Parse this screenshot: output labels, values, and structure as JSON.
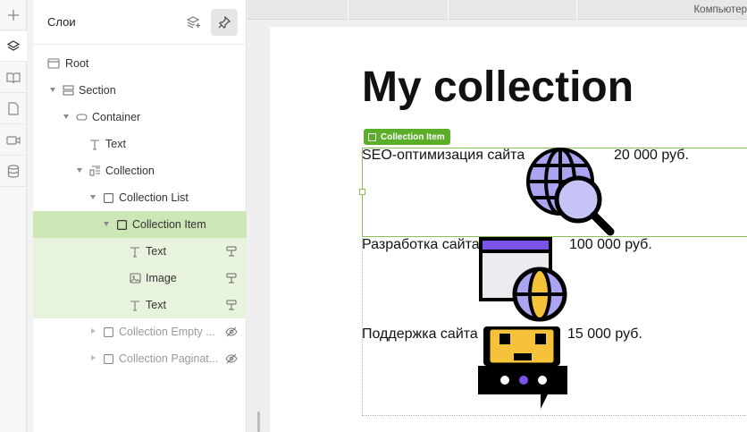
{
  "panel": {
    "title": "Слои"
  },
  "topbar": {
    "device": "Компьютер"
  },
  "rail": {
    "icons": [
      "plus-icon",
      "layers-icon",
      "book-icon",
      "page-icon",
      "video-icon",
      "database-icon"
    ]
  },
  "tree": [
    {
      "label": "Root",
      "icon": "frame-icon",
      "depth": 0
    },
    {
      "label": "Section",
      "icon": "section-icon",
      "depth": 1
    },
    {
      "label": "Container",
      "icon": "container-icon",
      "depth": 2
    },
    {
      "label": "Text",
      "icon": "text-icon",
      "depth": 3
    },
    {
      "label": "Collection",
      "icon": "collection-icon",
      "depth": 3
    },
    {
      "label": "Collection List",
      "icon": "square-icon",
      "depth": 4
    },
    {
      "label": "Collection Item",
      "icon": "square-icon",
      "depth": 5,
      "selected": true
    },
    {
      "label": "Text",
      "icon": "text-icon",
      "depth": 6,
      "badge": "bind-icon"
    },
    {
      "label": "Image",
      "icon": "image-icon",
      "depth": 6,
      "badge": "bind-icon"
    },
    {
      "label": "Text",
      "icon": "text-icon",
      "depth": 6,
      "badge": "bind-icon"
    },
    {
      "label": "Collection Empty ...",
      "icon": "square-icon",
      "depth": 4,
      "hidden": true
    },
    {
      "label": "Collection Paginat...",
      "icon": "square-icon",
      "depth": 4,
      "hidden": true
    }
  ],
  "canvas": {
    "heading": "My collection",
    "selected_tag": "Collection Item",
    "items": [
      {
        "name": "SEO-оптимизация сайта",
        "price": "20 000 руб.",
        "image": "seo-globe-icon"
      },
      {
        "name": "Разработка сайта",
        "price": "100 000 руб.",
        "image": "web-dev-icon"
      },
      {
        "name": "Поддержка сайта",
        "price": "15 000 руб.",
        "image": "support-robot-icon"
      }
    ]
  },
  "colors": {
    "accent_green": "#5aae2a",
    "selected_row": "#cde6b6",
    "child_row": "#e7f3dc",
    "illustration_purple": "#a9a5f0",
    "illustration_yellow": "#f5c23a"
  }
}
